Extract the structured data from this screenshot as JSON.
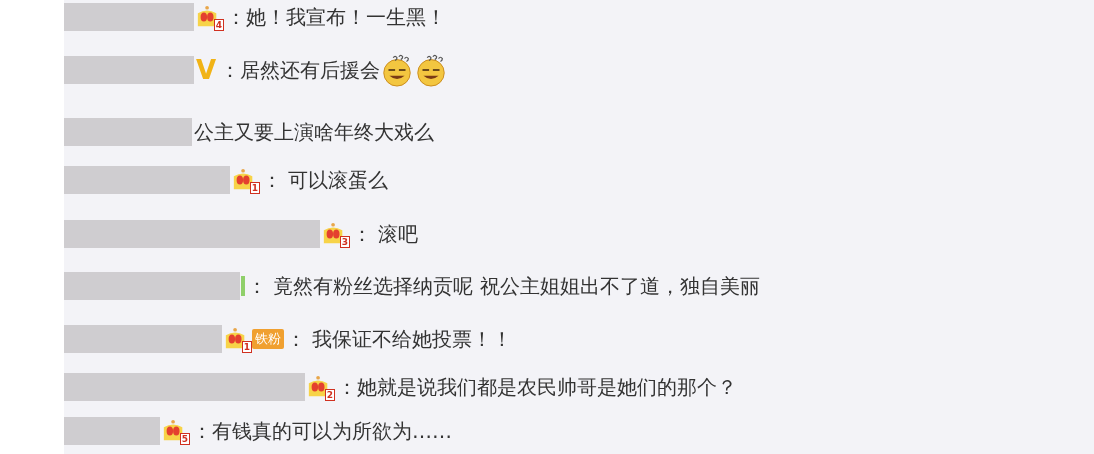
{
  "comments": [
    {
      "badge": {
        "kind": "crown",
        "rank": "4"
      },
      "text": "：她！我宣布！一生黑！"
    },
    {
      "badge": {
        "kind": "vip",
        "mark": "V"
      },
      "text": "：居然还有后援会",
      "emojis": [
        {
          "kind": "dizzy"
        },
        {
          "kind": "dizzy"
        }
      ]
    },
    {
      "badge": {
        "kind": "none"
      },
      "text": "公主又要上演啥年终大戏么"
    },
    {
      "badge": {
        "kind": "crown",
        "rank": "1"
      },
      "text": "： 可以滚蛋么"
    },
    {
      "badge": {
        "kind": "crown",
        "rank": "3"
      },
      "text": "： 滚吧"
    },
    {
      "badge": {
        "kind": "sliver"
      },
      "text": "： 竟然有粉丝选择纳贡呢 祝公主姐姐出不了道，独自美丽"
    },
    {
      "badge": {
        "kind": "fan",
        "rank": "1",
        "label": "铁粉"
      },
      "text": "： 我保证不给她投票！！"
    },
    {
      "badge": {
        "kind": "crown",
        "rank": "2"
      },
      "text": "：她就是说我们都是农民帅哥是她们的那个？"
    },
    {
      "badge": {
        "kind": "crown",
        "rank": "5"
      },
      "text": "：有钱真的可以为所欲为……"
    }
  ]
}
